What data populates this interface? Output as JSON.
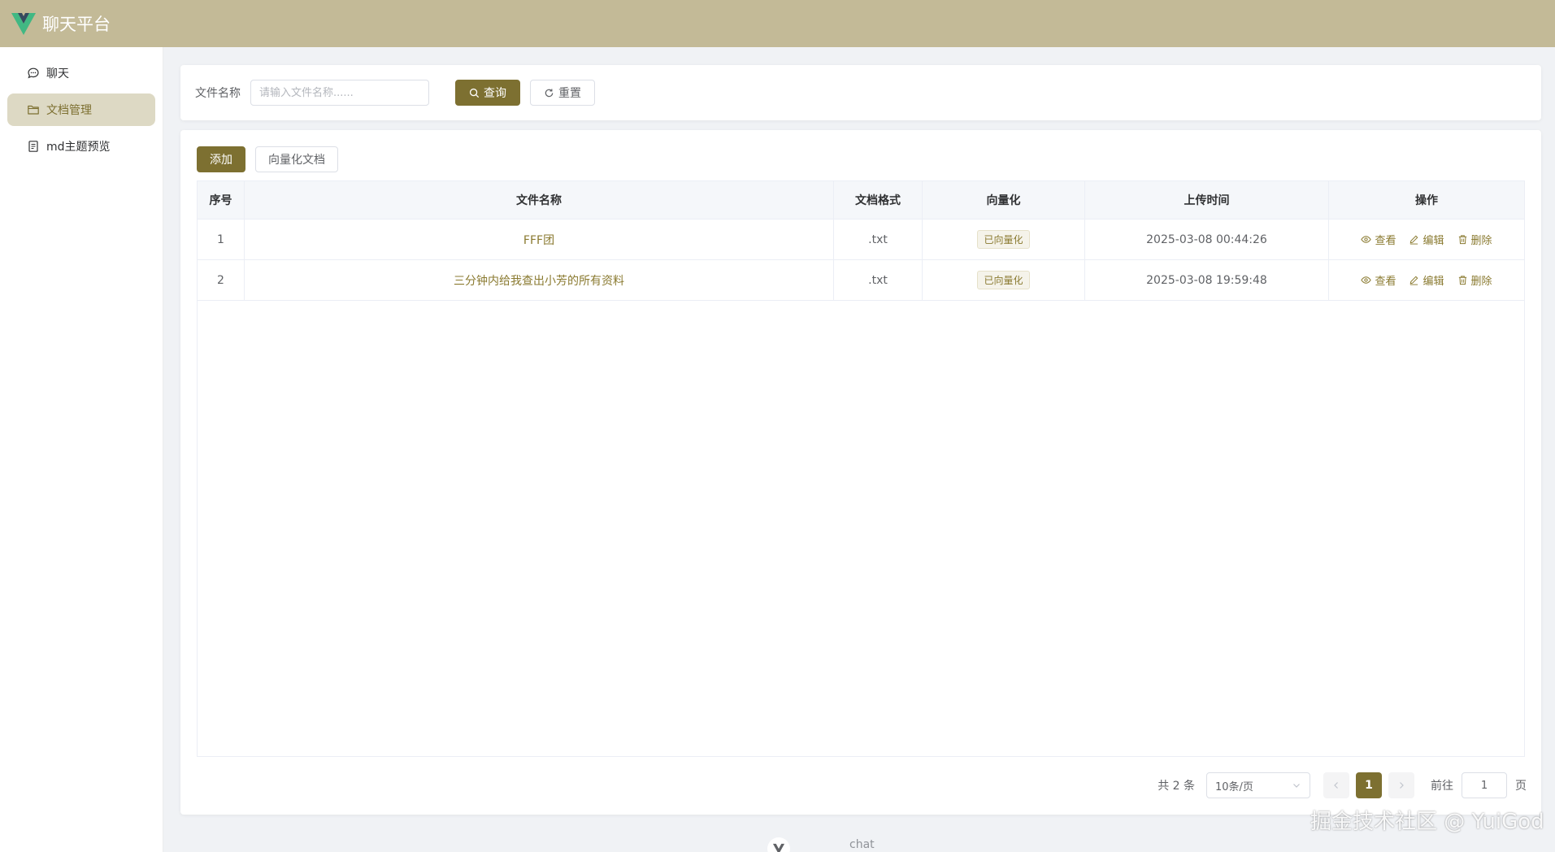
{
  "header": {
    "title": "聊天平台",
    "logo_icon": "vue-logo-icon",
    "bg_color": "#c3ba97"
  },
  "sidebar": {
    "items": [
      {
        "label": "聊天",
        "icon": "chat-bubble-icon",
        "active": false
      },
      {
        "label": "文档管理",
        "icon": "folder-icon",
        "active": true
      },
      {
        "label": "md主题预览",
        "icon": "document-icon",
        "active": false
      }
    ]
  },
  "search": {
    "label": "文件名称",
    "placeholder": "请输入文件名称......",
    "value": "",
    "search_button": "查询",
    "reset_button": "重置"
  },
  "toolbar": {
    "add_button": "添加",
    "vectorize_button": "向量化文档"
  },
  "table": {
    "columns": [
      "序号",
      "文件名称",
      "文档格式",
      "向量化",
      "上传时间",
      "操作"
    ],
    "rows": [
      {
        "index": "1",
        "name": "FFF团",
        "format": ".txt",
        "vector": "已向量化",
        "time": "2025-03-08 00:44:26"
      },
      {
        "index": "2",
        "name": "三分钟内给我查出小芳的所有资料",
        "format": ".txt",
        "vector": "已向量化",
        "time": "2025-03-08 19:59:48"
      }
    ],
    "actions": {
      "view": "查看",
      "edit": "编辑",
      "delete": "删除"
    }
  },
  "pagination": {
    "total": "共 2 条",
    "page_size": "10条/页",
    "current_page": "1",
    "jump_label": "前往",
    "jump_value": "1",
    "page_suffix": "页"
  },
  "footer": {
    "text": "chat"
  },
  "watermark": "掘金技术社区 @ YuiGod",
  "colors": {
    "accent": "#7d7031",
    "link": "#8a7a30",
    "sidebar_active_bg": "#ddd9c4"
  }
}
